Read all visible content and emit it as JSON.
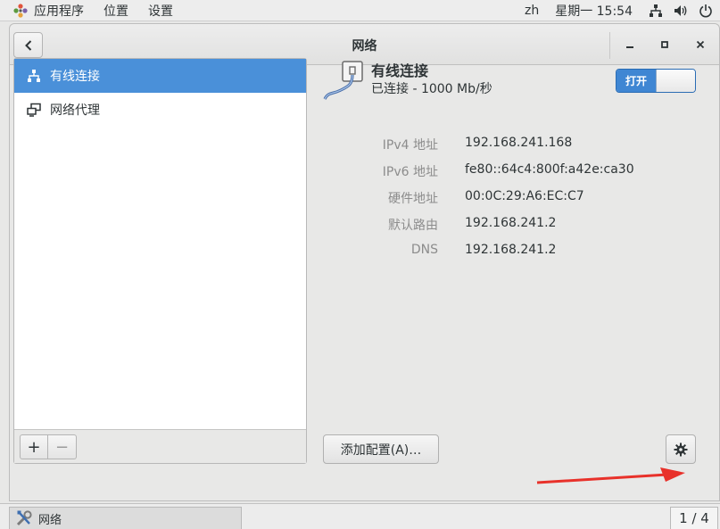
{
  "topbar": {
    "apps_label": "应用程序",
    "places_label": "位置",
    "settings_label": "设置",
    "input_method": "zh",
    "clock": "星期一 15:54"
  },
  "window": {
    "title": "网络",
    "minimize_glyph": "_",
    "maximize_glyph": "▫",
    "close_glyph": "✕"
  },
  "sidebar": {
    "items": [
      {
        "label": "有线连接",
        "icon": "wired-network-icon",
        "selected": true
      },
      {
        "label": "网络代理",
        "icon": "network-proxy-icon",
        "selected": false
      }
    ],
    "add_label": "+",
    "remove_label": "−"
  },
  "connection": {
    "title": "有线连接",
    "status": "已连接 - 1000 Mb/秒",
    "switch_label": "打开",
    "switch_on": true,
    "properties": [
      {
        "key": "IPv4 地址",
        "value": "192.168.241.168"
      },
      {
        "key": "IPv6 地址",
        "value": "fe80::64c4:800f:a42e:ca30"
      },
      {
        "key": "硬件地址",
        "value": "00:0C:29:A6:EC:C7"
      },
      {
        "key": "默认路由",
        "value": "192.168.241.2"
      },
      {
        "key": "DNS",
        "value": "192.168.241.2"
      }
    ],
    "add_profile_label": "添加配置(A)…"
  },
  "taskbar": {
    "task_label": "网络",
    "workspace": "1 / 4"
  },
  "colors": {
    "accent": "#4a90d9",
    "annotation_arrow": "#e8312a"
  }
}
